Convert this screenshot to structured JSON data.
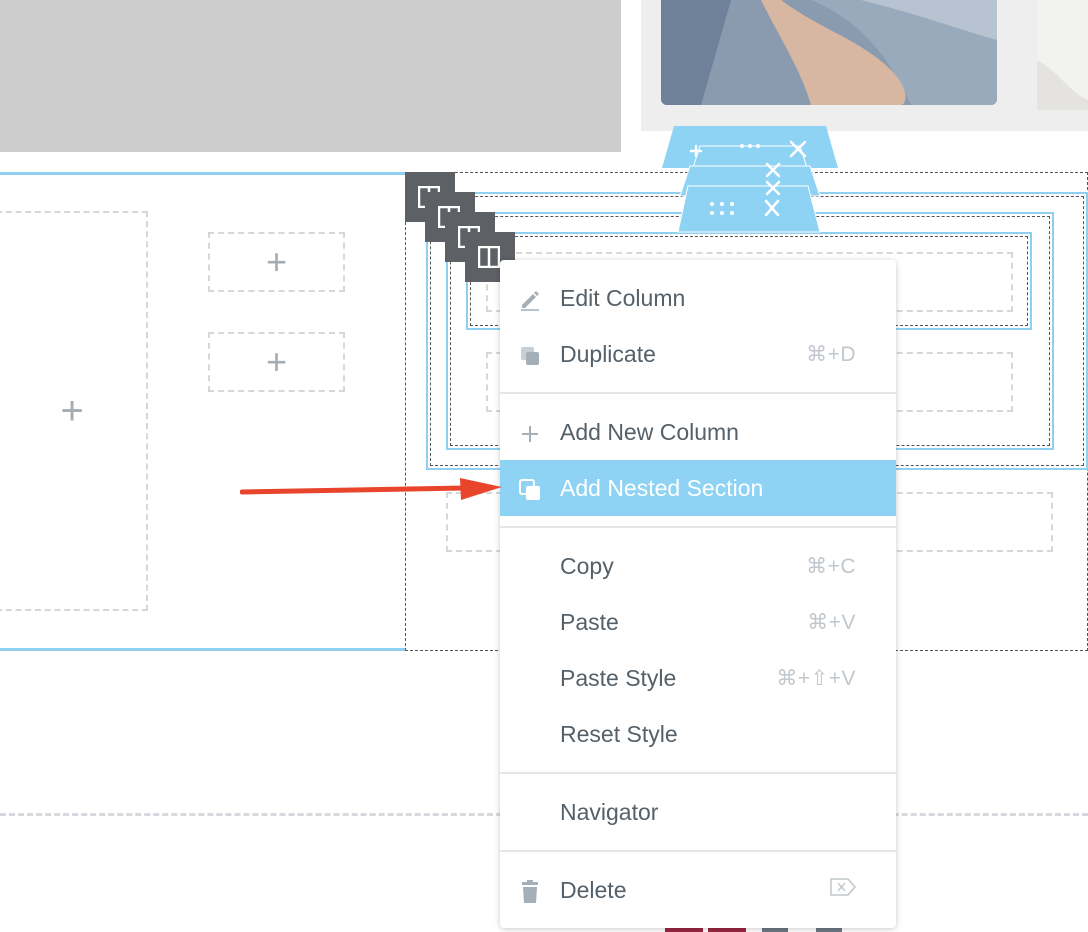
{
  "canvas": {
    "add_widget_icon": "plus-icon"
  },
  "column_handle": {
    "icon": "column-icon"
  },
  "section_tab": {
    "add_icon": "plus-icon",
    "drag_icon": "drag-handle-icon",
    "close_icon": "close-icon"
  },
  "context_menu": {
    "items": [
      {
        "label": "Edit Column",
        "shortcut": "",
        "icon": "pencil-icon"
      },
      {
        "label": "Duplicate",
        "shortcut": "⌘+D",
        "icon": "duplicate-icon"
      },
      {
        "label": "Add New Column",
        "shortcut": "",
        "icon": "plus-icon"
      },
      {
        "label": "Add Nested Section",
        "shortcut": "",
        "icon": "nested-section-icon",
        "highlighted": true
      },
      {
        "label": "Copy",
        "shortcut": "⌘+C"
      },
      {
        "label": "Paste",
        "shortcut": "⌘+V"
      },
      {
        "label": "Paste Style",
        "shortcut": "⌘+⇧+V"
      },
      {
        "label": "Reset Style",
        "shortcut": ""
      },
      {
        "label": "Navigator",
        "shortcut": ""
      },
      {
        "label": "Delete",
        "shortcut": "⌦",
        "icon": "trash-icon"
      }
    ]
  },
  "annotation": {
    "icon": "red-arrow-icon",
    "color": "#e8452c"
  },
  "colors": {
    "accent": "#8ed3f3",
    "handle": "#5d6166",
    "menu_text": "#556068"
  }
}
